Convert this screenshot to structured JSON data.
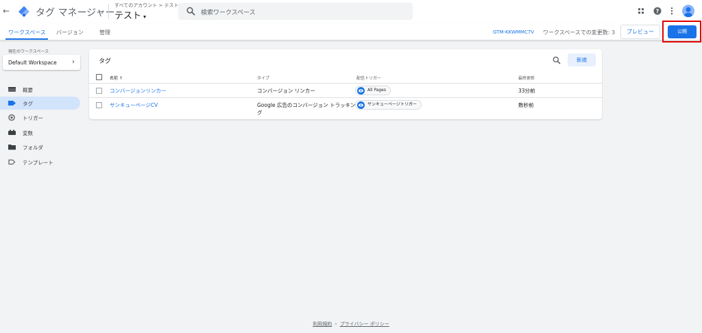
{
  "topbar": {
    "back_glyph": "←",
    "app_title": "タグ マネージャー",
    "breadcrumb": "すべてのアカウント > テスト",
    "account_name": "テスト",
    "account_caret": "▾",
    "search_placeholder": "検索ワークスペース",
    "icons": [
      "apps-grid-icon",
      "help-icon",
      "more-vert-icon",
      "account-avatar-icon"
    ]
  },
  "subbar": {
    "tabs": [
      {
        "label": "ワークスペース",
        "active": true
      },
      {
        "label": "バージョン",
        "active": false
      },
      {
        "label": "管理",
        "active": false
      }
    ],
    "container_id": "GTM-KKWMMC7V",
    "changes_text": "ワークスペースでの変更数: 3",
    "preview_label": "プレビュー",
    "publish_label": "公開"
  },
  "sidebar": {
    "workspace_label": "現在のワークスペース",
    "workspace_name": "Default Workspace",
    "workspace_chevron": "›",
    "items": [
      {
        "label": "概要",
        "icon": "overview-icon",
        "active": false
      },
      {
        "label": "タグ",
        "icon": "tag-icon",
        "active": true
      },
      {
        "label": "トリガー",
        "icon": "trigger-icon",
        "active": false
      },
      {
        "label": "変数",
        "icon": "variables-icon",
        "active": false
      },
      {
        "label": "フォルダ",
        "icon": "folder-icon",
        "active": false
      },
      {
        "label": "テンプレート",
        "icon": "template-icon",
        "active": false
      }
    ]
  },
  "tags_card": {
    "title": "タグ",
    "new_button": "新規",
    "columns": [
      "名前 ↑",
      "タイプ",
      "配信トリガー",
      "最終更新"
    ],
    "rows": [
      {
        "name": "コンバージョンリンカー",
        "type": "コンバージョン リンカー",
        "trigger": "All Pages",
        "updated": "33分前"
      },
      {
        "name": "サンキューページCV",
        "type": "Google 広告のコンバージョン トラッキング",
        "trigger": "サンキューページトリガー",
        "updated": "数秒前"
      }
    ]
  },
  "footer": {
    "terms": "利用規約",
    "separator": "・",
    "privacy": "プライバシー ポリシー"
  },
  "colors": {
    "accent": "#1a73e8",
    "highlight_box": "#e00000",
    "background": "#f1f3f4"
  }
}
